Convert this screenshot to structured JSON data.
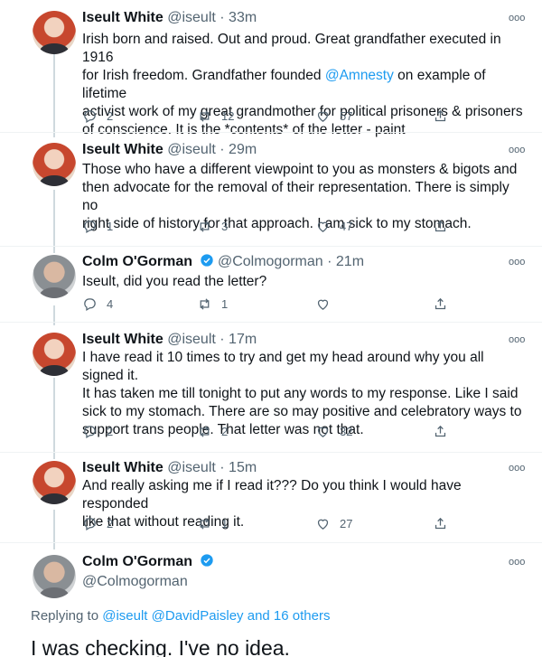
{
  "tweets": [
    {
      "name": "Iseult White",
      "handle": "@iseult",
      "time": "33m",
      "lines": [
        "Irish born and raised. Out and proud. Great grandfather executed in 1916",
        "for Irish freedom. Grandfather founded ",
        "activist work of my great grandmother for political prisoners & prisoners",
        "of conscience. It is the *contents* of the letter - paint"
      ],
      "mention": "@Amnesty",
      "line2_tail": " on example of lifetime",
      "replies": "2",
      "retweets": "12",
      "likes": "57"
    },
    {
      "name": "Iseult White",
      "handle": "@iseult",
      "time": "29m",
      "lines": [
        "Those who have a different viewpoint to you as monsters & bigots and",
        "then advocate for the removal of their representation. There is simply no",
        "right side of history for that approach. I am sick to my stomach."
      ],
      "replies": "1",
      "retweets": "3",
      "likes": "47"
    },
    {
      "name": "Colm O'Gorman",
      "handle": "@Colmogorman",
      "time": "21m",
      "lines": [
        "Iseult, did you read the letter?"
      ],
      "replies": "4",
      "retweets": "1",
      "likes": ""
    },
    {
      "name": "Iseult White",
      "handle": "@iseult",
      "time": "17m",
      "lines": [
        "I have read it 10 times to try and get my head around why you all signed it.",
        "It has taken me till tonight to put any words to my response. Like I said",
        "sick to my stomach. There are so may positive and celebratory ways to",
        "support trans people. That letter was not that."
      ],
      "replies": "2",
      "retweets": "2",
      "likes": "32"
    },
    {
      "name": "Iseult White",
      "handle": "@iseult",
      "time": "15m",
      "lines": [
        "And really asking me if I read it??? Do you think I would have responded",
        "like that without reading it."
      ],
      "replies": "2",
      "retweets": "1",
      "likes": "27"
    }
  ],
  "final_tweet": {
    "name": "Colm O'Gorman",
    "handle": "@Colmogorman",
    "replying_prefix": "Replying to ",
    "replying_users": "@iseult @DavidPaisley",
    "replying_suffix": " and 16 others",
    "text": "I was checking. I've no idea."
  },
  "separator": " · ",
  "more_glyph": "ooo",
  "colors": {
    "accent": "#1d9bf0",
    "muted": "#536471",
    "verified": "#1d9bf0"
  }
}
